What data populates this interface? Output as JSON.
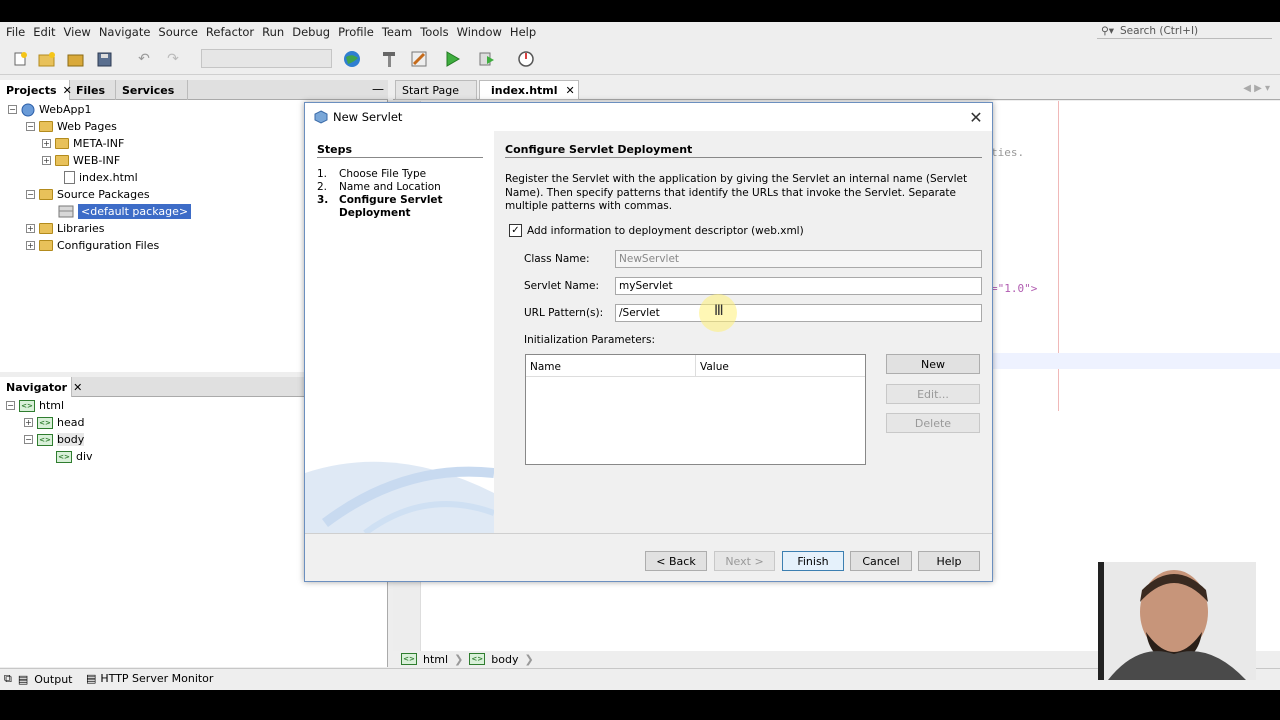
{
  "menu": [
    "File",
    "Edit",
    "View",
    "Navigate",
    "Source",
    "Refactor",
    "Run",
    "Debug",
    "Profile",
    "Team",
    "Tools",
    "Window",
    "Help"
  ],
  "search": {
    "placeholder": "Search (Ctrl+I)"
  },
  "projects_panel": {
    "tabs": [
      "Projects",
      "Files",
      "Services"
    ],
    "tree": {
      "project": "WebApp1",
      "web_pages": "Web Pages",
      "meta_inf": "META-INF",
      "web_inf": "WEB-INF",
      "index_html": "index.html",
      "source_packages": "Source Packages",
      "default_package": "<default package>",
      "libraries": "Libraries",
      "config_files": "Configuration Files"
    }
  },
  "navigator_panel": {
    "tab": "Navigator",
    "tree": {
      "html": "html",
      "head": "head",
      "body": "body",
      "div": "div"
    }
  },
  "editor": {
    "tabs": [
      "Start Page",
      "index.html"
    ],
    "code_fragment_1": "ties.",
    "code_fragment_2": "=\"1.0\">",
    "breadcrumb": [
      "html",
      "body"
    ]
  },
  "dialog": {
    "title": "New Servlet",
    "steps_heading": "Steps",
    "steps": [
      {
        "num": "1.",
        "label": "Choose File Type"
      },
      {
        "num": "2.",
        "label": "Name and Location"
      },
      {
        "num": "3.",
        "label": "Configure Servlet Deployment"
      }
    ],
    "section_heading": "Configure Servlet Deployment",
    "description": "Register the Servlet with the application by giving the Servlet an internal name (Servlet Name). Then specify patterns that identify the URLs that invoke the Servlet. Separate multiple patterns with commas.",
    "checkbox_label": "Add information to deployment descriptor (web.xml)",
    "class_name_label": "Class Name:",
    "class_name_value": "NewServlet",
    "servlet_name_label": "Servlet Name:",
    "servlet_name_value": "myServlet",
    "url_pattern_label": "URL Pattern(s):",
    "url_pattern_value": "/Servlet",
    "init_params_label": "Initialization Parameters:",
    "table_headers": [
      "Name",
      "Value"
    ],
    "param_buttons": {
      "new": "New",
      "edit": "Edit...",
      "delete": "Delete"
    },
    "footer_buttons": {
      "back": "< Back",
      "next": "Next >",
      "finish": "Finish",
      "cancel": "Cancel",
      "help": "Help"
    }
  },
  "statusbar": {
    "output": "Output",
    "http_monitor": "HTTP Server Monitor"
  },
  "colors": {
    "accent": "#3399ff",
    "selection": "#3d6cc7",
    "tag_green": "#2f7d2f"
  }
}
